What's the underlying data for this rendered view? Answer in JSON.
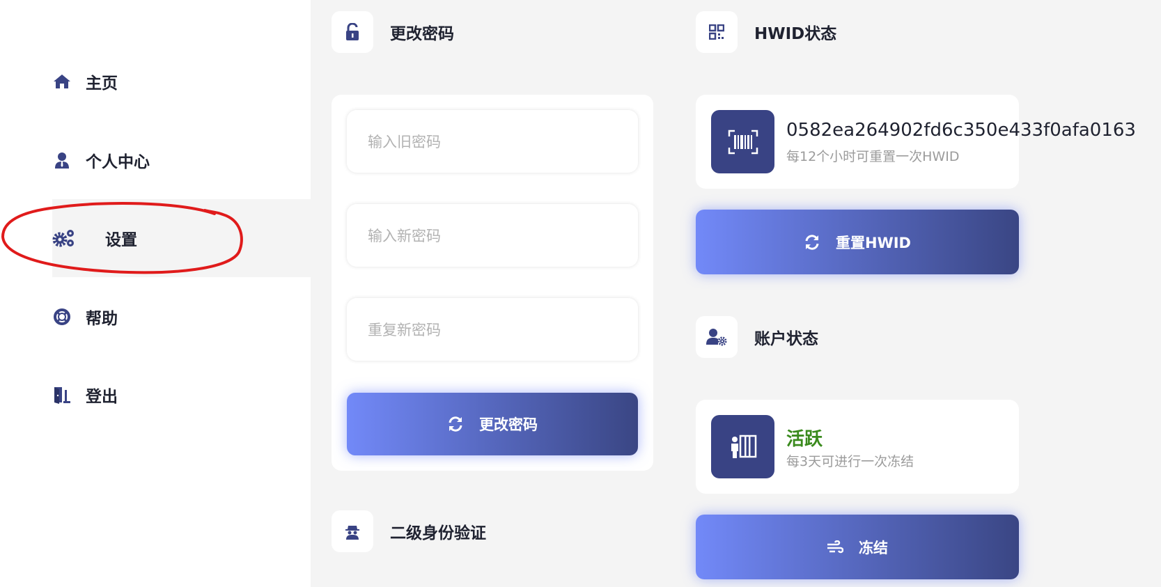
{
  "sidebar": {
    "items": [
      {
        "label": "主页",
        "icon": "home-icon"
      },
      {
        "label": "个人中心",
        "icon": "user-icon"
      },
      {
        "label": "设置",
        "icon": "gears-icon",
        "active": true
      },
      {
        "label": "帮助",
        "icon": "lifebuoy-icon"
      },
      {
        "label": "登出",
        "icon": "door-exit-icon"
      }
    ]
  },
  "password": {
    "title": "更改密码",
    "old_placeholder": "输入旧密码",
    "new_placeholder": "输入新密码",
    "repeat_placeholder": "重复新密码",
    "submit_label": "更改密码"
  },
  "two_factor": {
    "title": "二级身份验证"
  },
  "hwid": {
    "title": "HWID状态",
    "value": "0582ea264902fd6c350e433f0afa0163",
    "note": "每12个小时可重置一次HWID",
    "reset_label": "重置HWID"
  },
  "account": {
    "title": "账户状态",
    "status": "活跃",
    "note": "每3天可进行一次冻结",
    "freeze_label": "冻结"
  },
  "colors": {
    "accent_dark": "#394384",
    "accent_light": "#7289f8",
    "active_green": "#3a8a1d",
    "annotation_red": "#e01b1b"
  }
}
